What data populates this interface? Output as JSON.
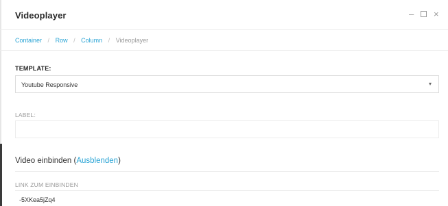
{
  "window": {
    "title": "Videoplayer",
    "minimize_glyph": "–",
    "close_glyph": "×"
  },
  "breadcrumb": {
    "items": [
      "Container",
      "Row",
      "Column",
      "Videoplayer"
    ],
    "separator": "/"
  },
  "template": {
    "label": "TEMPLATE:",
    "value": "Youtube Responsive",
    "caret_glyph": "▾"
  },
  "label_field": {
    "label": "LABEL:",
    "value": ""
  },
  "embed_section": {
    "title": "Video einbinden (",
    "toggle_link": "Ausblenden",
    "title_end": ")"
  },
  "embed_link": {
    "label": "LINK ZUM EINBINDEN",
    "value": "-5XKea5jZq4"
  },
  "colors": {
    "accent": "#2aa4d5",
    "border": "#dcdcdc",
    "text": "#333333",
    "muted": "#9a9a9a"
  },
  "icons": [
    "minimize-icon",
    "maximize-icon",
    "close-icon",
    "chevron-down-icon"
  ]
}
